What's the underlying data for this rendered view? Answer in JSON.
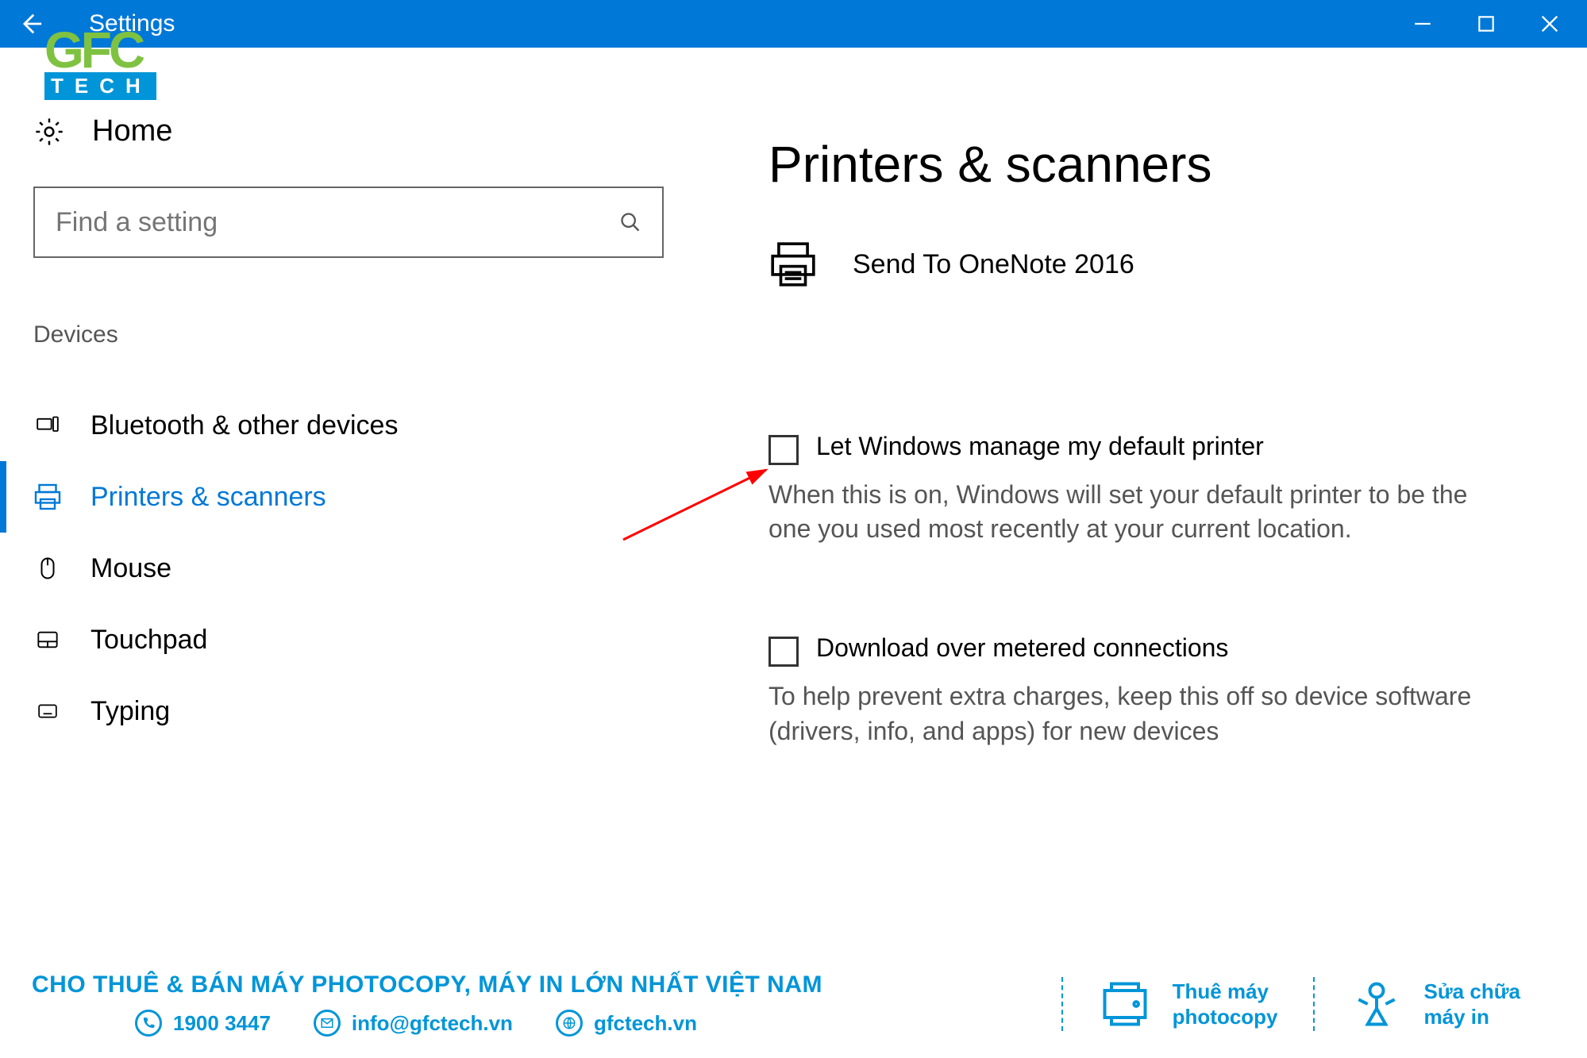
{
  "titlebar": {
    "title": "Settings"
  },
  "sidebar": {
    "home": "Home",
    "search_placeholder": "Find a setting",
    "section": "Devices",
    "items": [
      {
        "label": "Bluetooth & other devices"
      },
      {
        "label": "Printers & scanners"
      },
      {
        "label": "Mouse"
      },
      {
        "label": "Touchpad"
      },
      {
        "label": "Typing"
      }
    ]
  },
  "main": {
    "heading": "Printers & scanners",
    "printer_name": "Send To OneNote 2016",
    "check1_label": "Let Windows manage my default printer",
    "check1_desc": "When this is on, Windows will set your default printer to be the one you used most recently at your current location.",
    "check2_label": "Download over metered connections",
    "check2_desc": "To help prevent extra charges, keep this off so device software (drivers, info, and apps) for new devices"
  },
  "logo": {
    "line1": "GFC",
    "line2": "TECH"
  },
  "bottom": {
    "tagline": "CHO THUÊ & BÁN MÁY PHOTOCOPY, MÁY IN LỚN NHẤT VIỆT NAM",
    "phone": "1900 3447",
    "email": "info@gfctech.vn",
    "web": "gfctech.vn",
    "svc1a": "Thuê máy",
    "svc1b": "photocopy",
    "svc2a": "Sửa chữa",
    "svc2b": "máy in"
  }
}
